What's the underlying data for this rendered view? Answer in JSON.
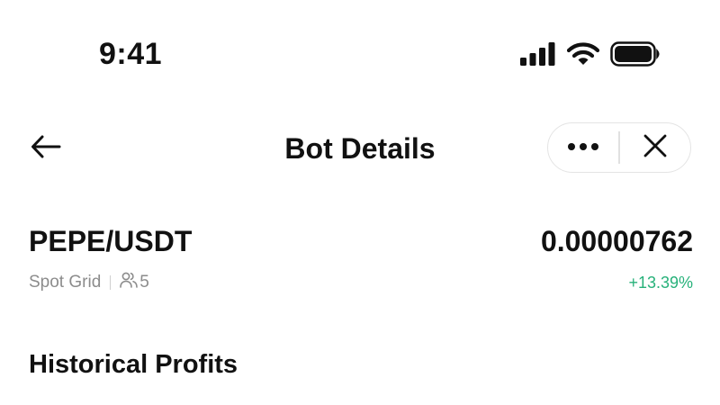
{
  "status_bar": {
    "time": "9:41",
    "icons": [
      "cellular-signal-icon",
      "wifi-icon",
      "battery-icon"
    ]
  },
  "nav": {
    "title": "Bot Details",
    "back_icon": "arrow-left-icon",
    "more_icon": "more-dots-icon",
    "close_icon": "close-icon"
  },
  "pair": {
    "name": "PEPE/USDT",
    "price": "0.00000762",
    "strategy": "Spot Grid",
    "users_icon": "users-icon",
    "user_count": "5",
    "change": "+13.39%",
    "change_color": "#27b17a"
  },
  "sections": {
    "historical_profits": "Historical Profits"
  }
}
